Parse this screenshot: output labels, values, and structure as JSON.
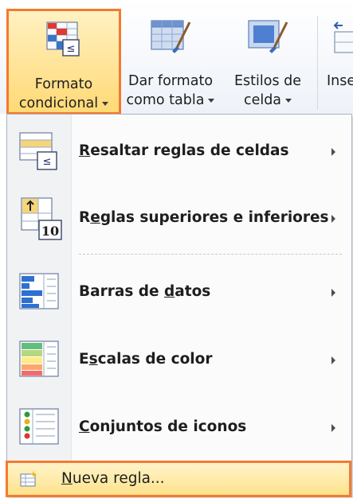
{
  "ribbon": {
    "conditional_format": {
      "line1": "Formato",
      "line2": "condicional"
    },
    "format_as_table": {
      "line1": "Dar formato",
      "line2": "como tabla"
    },
    "cell_styles": {
      "line1": "Estilos de",
      "line2": "celda"
    },
    "insert": {
      "line1": "Inse"
    }
  },
  "menu": {
    "items": [
      {
        "pre": "",
        "key": "R",
        "post": "esaltar reglas de celdas",
        "icon": "highlight-cells-rules-icon"
      },
      {
        "pre": "R",
        "key": "e",
        "post": "glas superiores e inferiores",
        "icon": "top-bottom-rules-icon"
      },
      {
        "pre": "Barras de ",
        "key": "d",
        "post": "atos",
        "icon": "data-bars-icon"
      },
      {
        "pre": "E",
        "key": "s",
        "post": "calas de color",
        "icon": "color-scales-icon"
      },
      {
        "pre": "",
        "key": "C",
        "post": "onjuntos de iconos",
        "icon": "icon-sets-icon"
      }
    ],
    "new_rule": {
      "key": "N",
      "post": "ueva regla...",
      "icon": "new-rule-icon"
    },
    "top_rules_icon_number": "10"
  },
  "colors": {
    "highlight_outline": "#f47a30",
    "highlight_fill": "#ffe28c",
    "excel_blue": "#2f5fa8"
  }
}
